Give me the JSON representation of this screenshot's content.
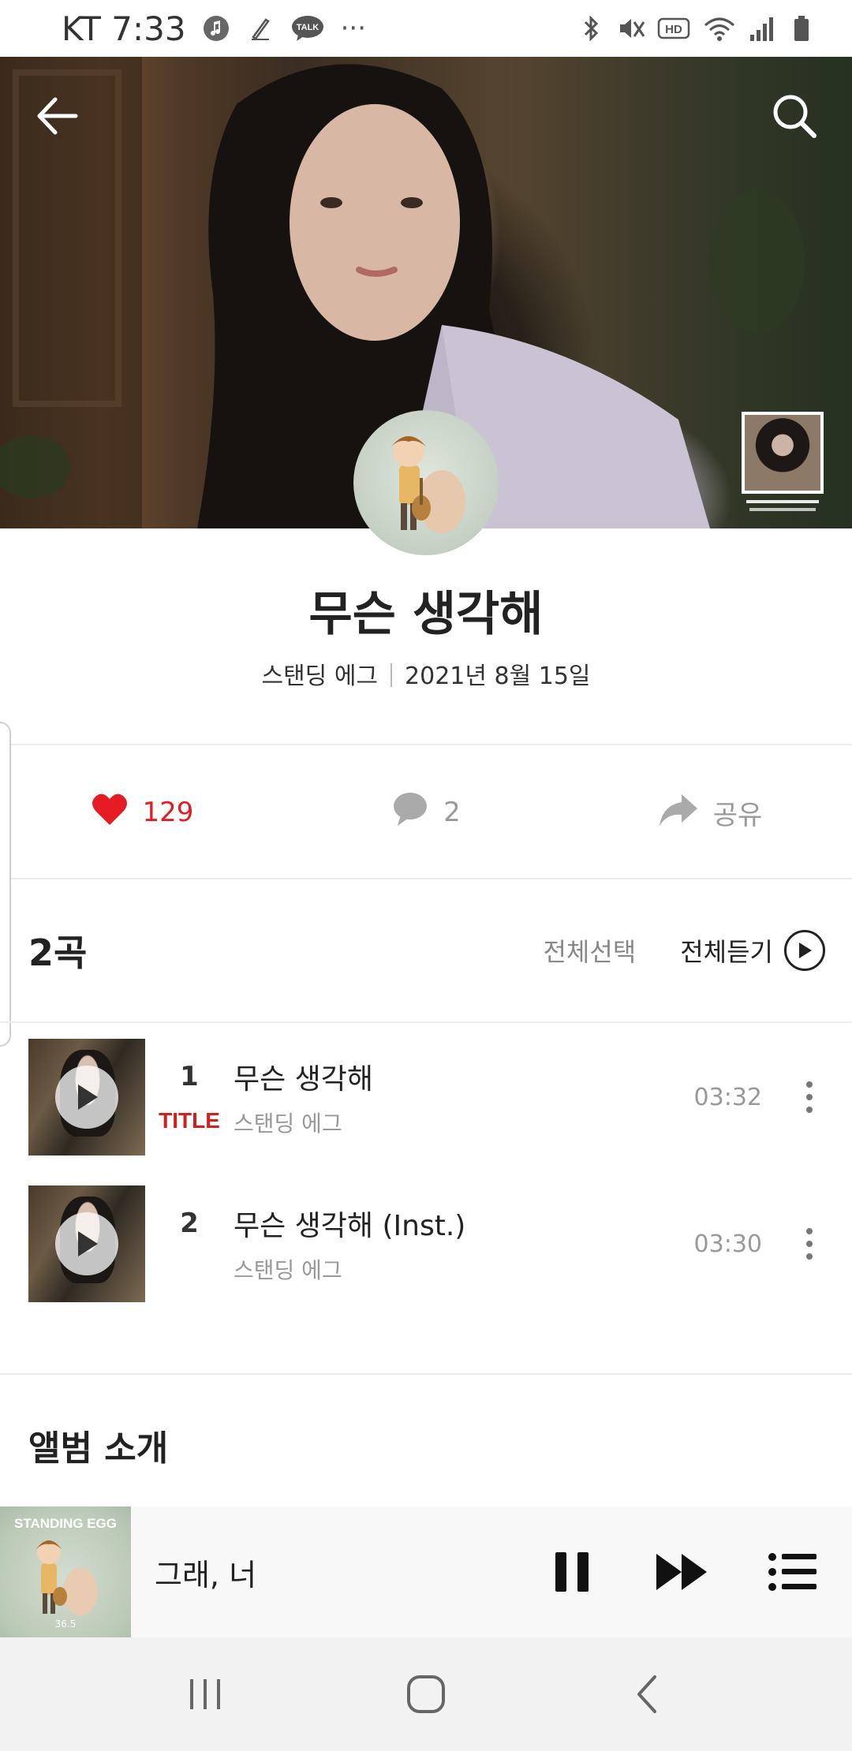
{
  "status_bar": {
    "carrier_time": "KT 7:33",
    "dots": "···",
    "talk_label": "TALK",
    "hd_label": "HD"
  },
  "album": {
    "title": "무슨 생각해",
    "artist": "스탠딩 에그",
    "release_date": "2021년 8월 15일"
  },
  "actions": {
    "likes": "129",
    "comments": "2",
    "share_label": "공유",
    "like_color": "#e51c23"
  },
  "track_list": {
    "count_label": "2곡",
    "select_all_label": "전체선택",
    "play_all_label": "전체듣기",
    "tracks": [
      {
        "number": "1",
        "badge": "TITLE",
        "title": "무슨 생각해",
        "artist": "스탠딩 에그",
        "duration": "03:32"
      },
      {
        "number": "2",
        "badge": "",
        "title": "무슨 생각해 (Inst.)",
        "artist": "스탠딩 에그",
        "duration": "03:30"
      }
    ]
  },
  "album_intro": {
    "section_title": "앨범 소개"
  },
  "mini_player": {
    "song_title": "그래, 너",
    "cover_brand": "STANDING EGG",
    "cover_number": "36.5"
  },
  "icons": [
    "back-arrow-icon",
    "search-icon",
    "heart-icon",
    "comment-icon",
    "share-icon",
    "play-icon",
    "more-icon",
    "pause-icon",
    "next-icon",
    "playlist-icon",
    "recents-icon",
    "home-icon",
    "nav-back-icon"
  ]
}
